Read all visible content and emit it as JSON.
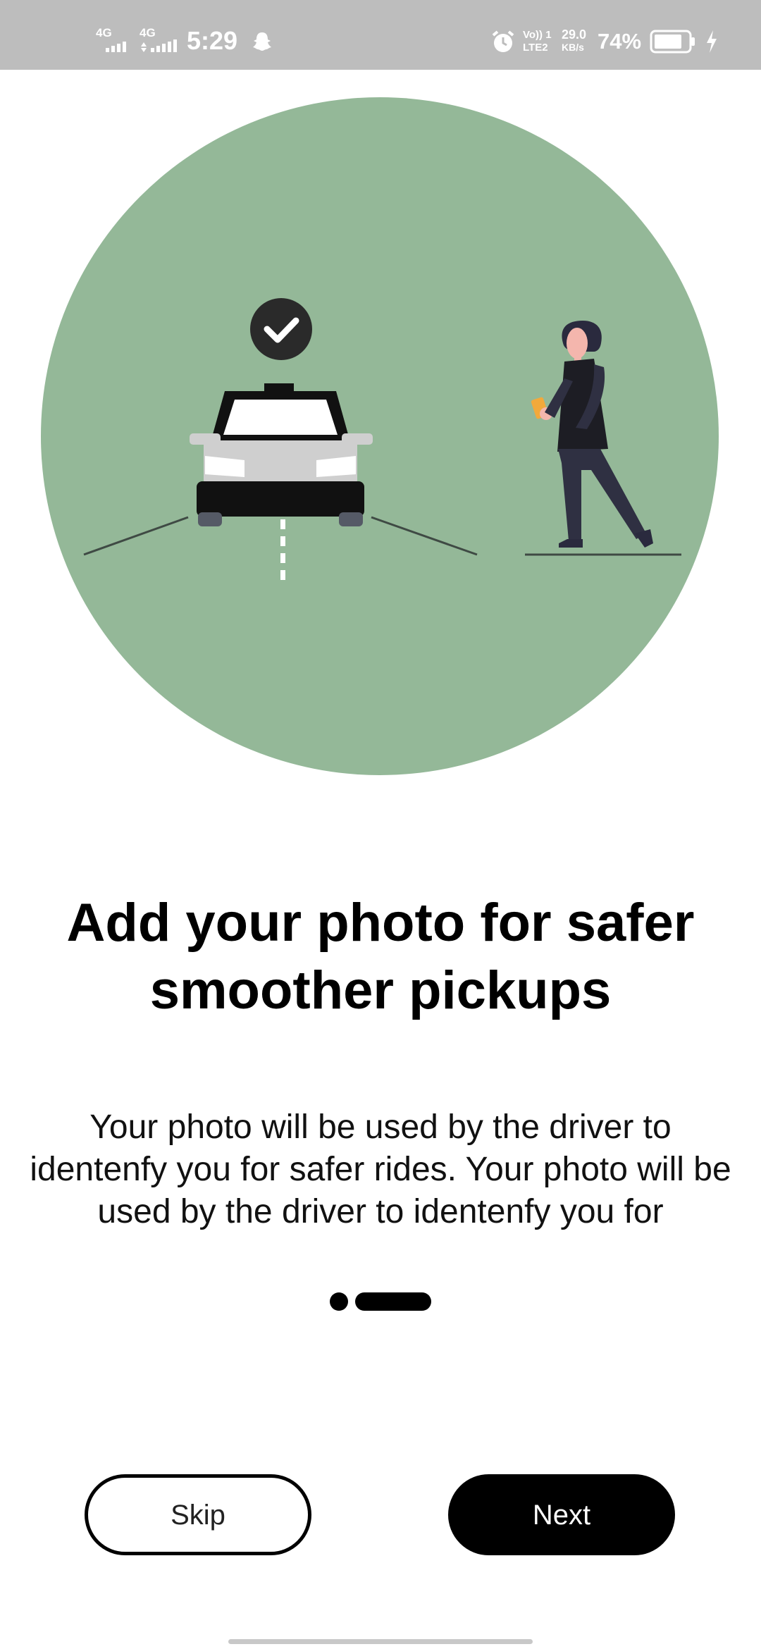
{
  "status_bar": {
    "sim1": "4G",
    "sim2": "4G",
    "time": "5:29",
    "volte": "VoLTE2",
    "volte_top": "Vo)) 1",
    "volte_bottom": "LTE2",
    "speed_value": "29.0",
    "speed_unit": "KB/s",
    "battery_percent": "74%",
    "icons": [
      "signal-icon",
      "snapchat-icon",
      "alarm-icon",
      "battery-icon",
      "charging-icon"
    ]
  },
  "onboarding": {
    "title": "Add your photo for safer smoother pickups",
    "description": "Your photo will be used by the driver to identenfy you for safer rides. Your photo will be used by the driver to identenfy you for",
    "page_indicator": {
      "total": 2,
      "current": 2
    }
  },
  "actions": {
    "skip_label": "Skip",
    "next_label": "Next"
  },
  "colors": {
    "illustration_bg": "#94b898",
    "primary": "#000000",
    "status_bar": "#bdbdbd"
  }
}
